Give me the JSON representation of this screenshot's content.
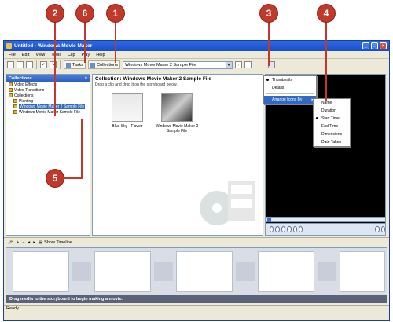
{
  "window": {
    "title": "Untitled - Windows Movie Maker",
    "minimize": "_",
    "maximize": "□",
    "close": "×"
  },
  "menu": [
    "File",
    "Edit",
    "View",
    "Tools",
    "Clip",
    "Play",
    "Help"
  ],
  "toolbar": {
    "tasks_label": "Tasks",
    "collections_label": "Collections",
    "collection_combo_value": "Windows Movie Maker 2 Sample File"
  },
  "collections_pane": {
    "header": "Collections",
    "close": "×",
    "items": [
      {
        "label": "Video Effects"
      },
      {
        "label": "Video Transitions"
      },
      {
        "label": "Collections"
      },
      {
        "label": "Planting"
      },
      {
        "label": "Windows Movie Maker 2 Sample File"
      },
      {
        "label": "Windows Movie Maker Sample File"
      }
    ]
  },
  "content": {
    "title": "Collection: Windows Movie Maker 2 Sample File",
    "subtitle": "Drag a clip and drop it on the storyboard below.",
    "clips": [
      {
        "label": "Blue Sky - Flower"
      },
      {
        "label": "Windows Movie Maker 2 Sample File"
      }
    ]
  },
  "views_menu": {
    "items": [
      "Thumbnails",
      "Details",
      "Arrange Icons By"
    ],
    "submenu": [
      "Name",
      "Duration",
      "Start Time",
      "End Time",
      "Dimensions",
      "Date Taken"
    ]
  },
  "storyboard": {
    "show_timeline": "Show Timeline",
    "hint": "Drag media to the storyboard to begin making a movie."
  },
  "status": "Ready",
  "callouts": [
    "1",
    "2",
    "3",
    "4",
    "5",
    "6"
  ],
  "colors": {
    "callout": "#c0392b",
    "titlebar": "#2b6ae6",
    "selection": "#316ac5"
  }
}
